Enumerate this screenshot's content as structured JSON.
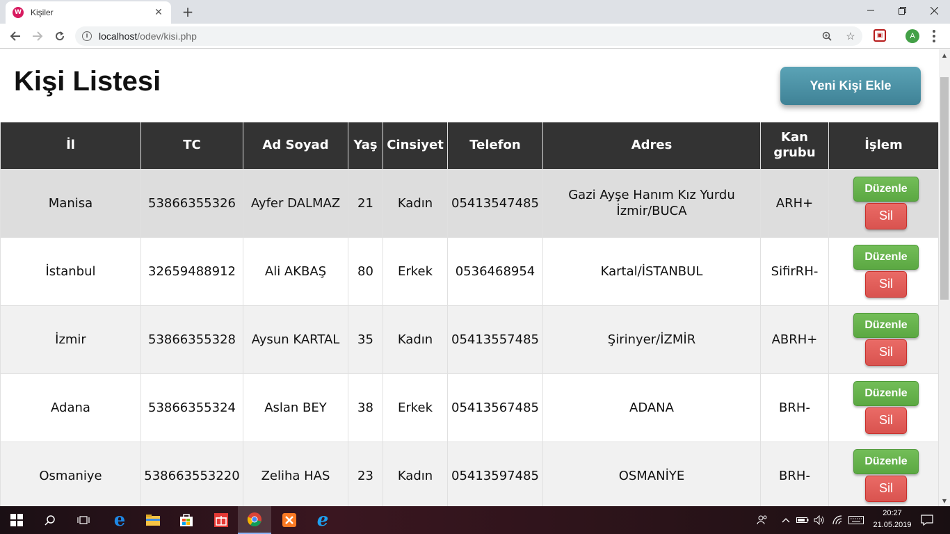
{
  "browser": {
    "tab_title": "Kişiler",
    "tab_favicon": "W",
    "new_tab_label": "+",
    "url_host": "localhost",
    "url_path": "/odev/kisi.php",
    "profile_initial": "A"
  },
  "page": {
    "title": "Kişi Listesi",
    "add_button": "Yeni Kişi Ekle"
  },
  "table": {
    "headers": [
      "İl",
      "TC",
      "Ad Soyad",
      "Yaş",
      "Cinsiyet",
      "Telefon",
      "Adres",
      "Kan grubu",
      "İşlem"
    ],
    "rows": [
      {
        "il": "Manisa",
        "tc": "53866355326",
        "ad_soyad": "Ayfer DALMAZ",
        "yas": "21",
        "cinsiyet": "Kadın",
        "telefon": "05413547485",
        "adres": "Gazi Ayşe Hanım Kız Yurdu İzmir/BUCA",
        "kan_grubu": "ARH+"
      },
      {
        "il": "İstanbul",
        "tc": "32659488912",
        "ad_soyad": "Ali AKBAŞ",
        "yas": "80",
        "cinsiyet": "Erkek",
        "telefon": "0536468954",
        "adres": "Kartal/İSTANBUL",
        "kan_grubu": "SifirRH-"
      },
      {
        "il": "İzmir",
        "tc": "53866355328",
        "ad_soyad": "Aysun KARTAL",
        "yas": "35",
        "cinsiyet": "Kadın",
        "telefon": "05413557485",
        "adres": "Şirinyer/İZMİR",
        "kan_grubu": "ABRH+"
      },
      {
        "il": "Adana",
        "tc": "53866355324",
        "ad_soyad": "Aslan BEY",
        "yas": "38",
        "cinsiyet": "Erkek",
        "telefon": "05413567485",
        "adres": "ADANA",
        "kan_grubu": "BRH-"
      },
      {
        "il": "Osmaniye",
        "tc": "538663553220",
        "ad_soyad": "Zeliha HAS",
        "yas": "23",
        "cinsiyet": "Kadın",
        "telefon": "05413597485",
        "adres": "OSMANİYE",
        "kan_grubu": "BRH-"
      }
    ],
    "edit_label": "Düzenle",
    "delete_label": "Sil"
  },
  "taskbar": {
    "time": "20:27",
    "date": "21.05.2019"
  },
  "colors": {
    "header_bg": "#333333",
    "edit_button": "#5cb85c",
    "delete_button": "#d9534f",
    "add_button": "#4a90a4"
  }
}
